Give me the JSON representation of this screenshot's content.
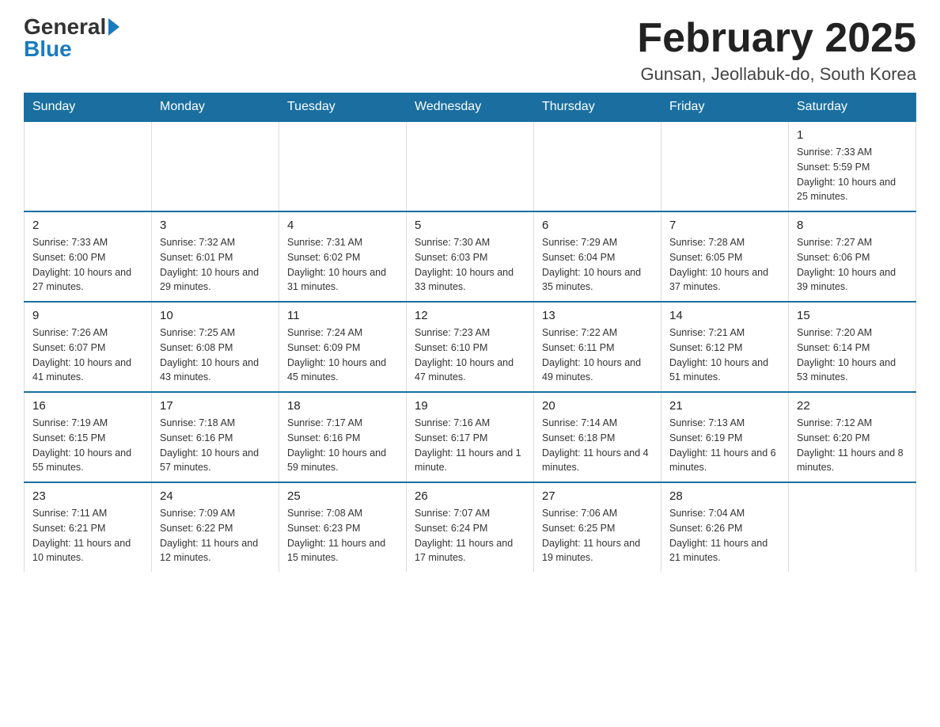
{
  "logo": {
    "general": "General",
    "blue": "Blue",
    "arrow": "▶"
  },
  "title": "February 2025",
  "location": "Gunsan, Jeollabuk-do, South Korea",
  "days_of_week": [
    "Sunday",
    "Monday",
    "Tuesday",
    "Wednesday",
    "Thursday",
    "Friday",
    "Saturday"
  ],
  "weeks": [
    [
      {
        "day": "",
        "info": ""
      },
      {
        "day": "",
        "info": ""
      },
      {
        "day": "",
        "info": ""
      },
      {
        "day": "",
        "info": ""
      },
      {
        "day": "",
        "info": ""
      },
      {
        "day": "",
        "info": ""
      },
      {
        "day": "1",
        "info": "Sunrise: 7:33 AM\nSunset: 5:59 PM\nDaylight: 10 hours and 25 minutes."
      }
    ],
    [
      {
        "day": "2",
        "info": "Sunrise: 7:33 AM\nSunset: 6:00 PM\nDaylight: 10 hours and 27 minutes."
      },
      {
        "day": "3",
        "info": "Sunrise: 7:32 AM\nSunset: 6:01 PM\nDaylight: 10 hours and 29 minutes."
      },
      {
        "day": "4",
        "info": "Sunrise: 7:31 AM\nSunset: 6:02 PM\nDaylight: 10 hours and 31 minutes."
      },
      {
        "day": "5",
        "info": "Sunrise: 7:30 AM\nSunset: 6:03 PM\nDaylight: 10 hours and 33 minutes."
      },
      {
        "day": "6",
        "info": "Sunrise: 7:29 AM\nSunset: 6:04 PM\nDaylight: 10 hours and 35 minutes."
      },
      {
        "day": "7",
        "info": "Sunrise: 7:28 AM\nSunset: 6:05 PM\nDaylight: 10 hours and 37 minutes."
      },
      {
        "day": "8",
        "info": "Sunrise: 7:27 AM\nSunset: 6:06 PM\nDaylight: 10 hours and 39 minutes."
      }
    ],
    [
      {
        "day": "9",
        "info": "Sunrise: 7:26 AM\nSunset: 6:07 PM\nDaylight: 10 hours and 41 minutes."
      },
      {
        "day": "10",
        "info": "Sunrise: 7:25 AM\nSunset: 6:08 PM\nDaylight: 10 hours and 43 minutes."
      },
      {
        "day": "11",
        "info": "Sunrise: 7:24 AM\nSunset: 6:09 PM\nDaylight: 10 hours and 45 minutes."
      },
      {
        "day": "12",
        "info": "Sunrise: 7:23 AM\nSunset: 6:10 PM\nDaylight: 10 hours and 47 minutes."
      },
      {
        "day": "13",
        "info": "Sunrise: 7:22 AM\nSunset: 6:11 PM\nDaylight: 10 hours and 49 minutes."
      },
      {
        "day": "14",
        "info": "Sunrise: 7:21 AM\nSunset: 6:12 PM\nDaylight: 10 hours and 51 minutes."
      },
      {
        "day": "15",
        "info": "Sunrise: 7:20 AM\nSunset: 6:14 PM\nDaylight: 10 hours and 53 minutes."
      }
    ],
    [
      {
        "day": "16",
        "info": "Sunrise: 7:19 AM\nSunset: 6:15 PM\nDaylight: 10 hours and 55 minutes."
      },
      {
        "day": "17",
        "info": "Sunrise: 7:18 AM\nSunset: 6:16 PM\nDaylight: 10 hours and 57 minutes."
      },
      {
        "day": "18",
        "info": "Sunrise: 7:17 AM\nSunset: 6:16 PM\nDaylight: 10 hours and 59 minutes."
      },
      {
        "day": "19",
        "info": "Sunrise: 7:16 AM\nSunset: 6:17 PM\nDaylight: 11 hours and 1 minute."
      },
      {
        "day": "20",
        "info": "Sunrise: 7:14 AM\nSunset: 6:18 PM\nDaylight: 11 hours and 4 minutes."
      },
      {
        "day": "21",
        "info": "Sunrise: 7:13 AM\nSunset: 6:19 PM\nDaylight: 11 hours and 6 minutes."
      },
      {
        "day": "22",
        "info": "Sunrise: 7:12 AM\nSunset: 6:20 PM\nDaylight: 11 hours and 8 minutes."
      }
    ],
    [
      {
        "day": "23",
        "info": "Sunrise: 7:11 AM\nSunset: 6:21 PM\nDaylight: 11 hours and 10 minutes."
      },
      {
        "day": "24",
        "info": "Sunrise: 7:09 AM\nSunset: 6:22 PM\nDaylight: 11 hours and 12 minutes."
      },
      {
        "day": "25",
        "info": "Sunrise: 7:08 AM\nSunset: 6:23 PM\nDaylight: 11 hours and 15 minutes."
      },
      {
        "day": "26",
        "info": "Sunrise: 7:07 AM\nSunset: 6:24 PM\nDaylight: 11 hours and 17 minutes."
      },
      {
        "day": "27",
        "info": "Sunrise: 7:06 AM\nSunset: 6:25 PM\nDaylight: 11 hours and 19 minutes."
      },
      {
        "day": "28",
        "info": "Sunrise: 7:04 AM\nSunset: 6:26 PM\nDaylight: 11 hours and 21 minutes."
      },
      {
        "day": "",
        "info": ""
      }
    ]
  ]
}
